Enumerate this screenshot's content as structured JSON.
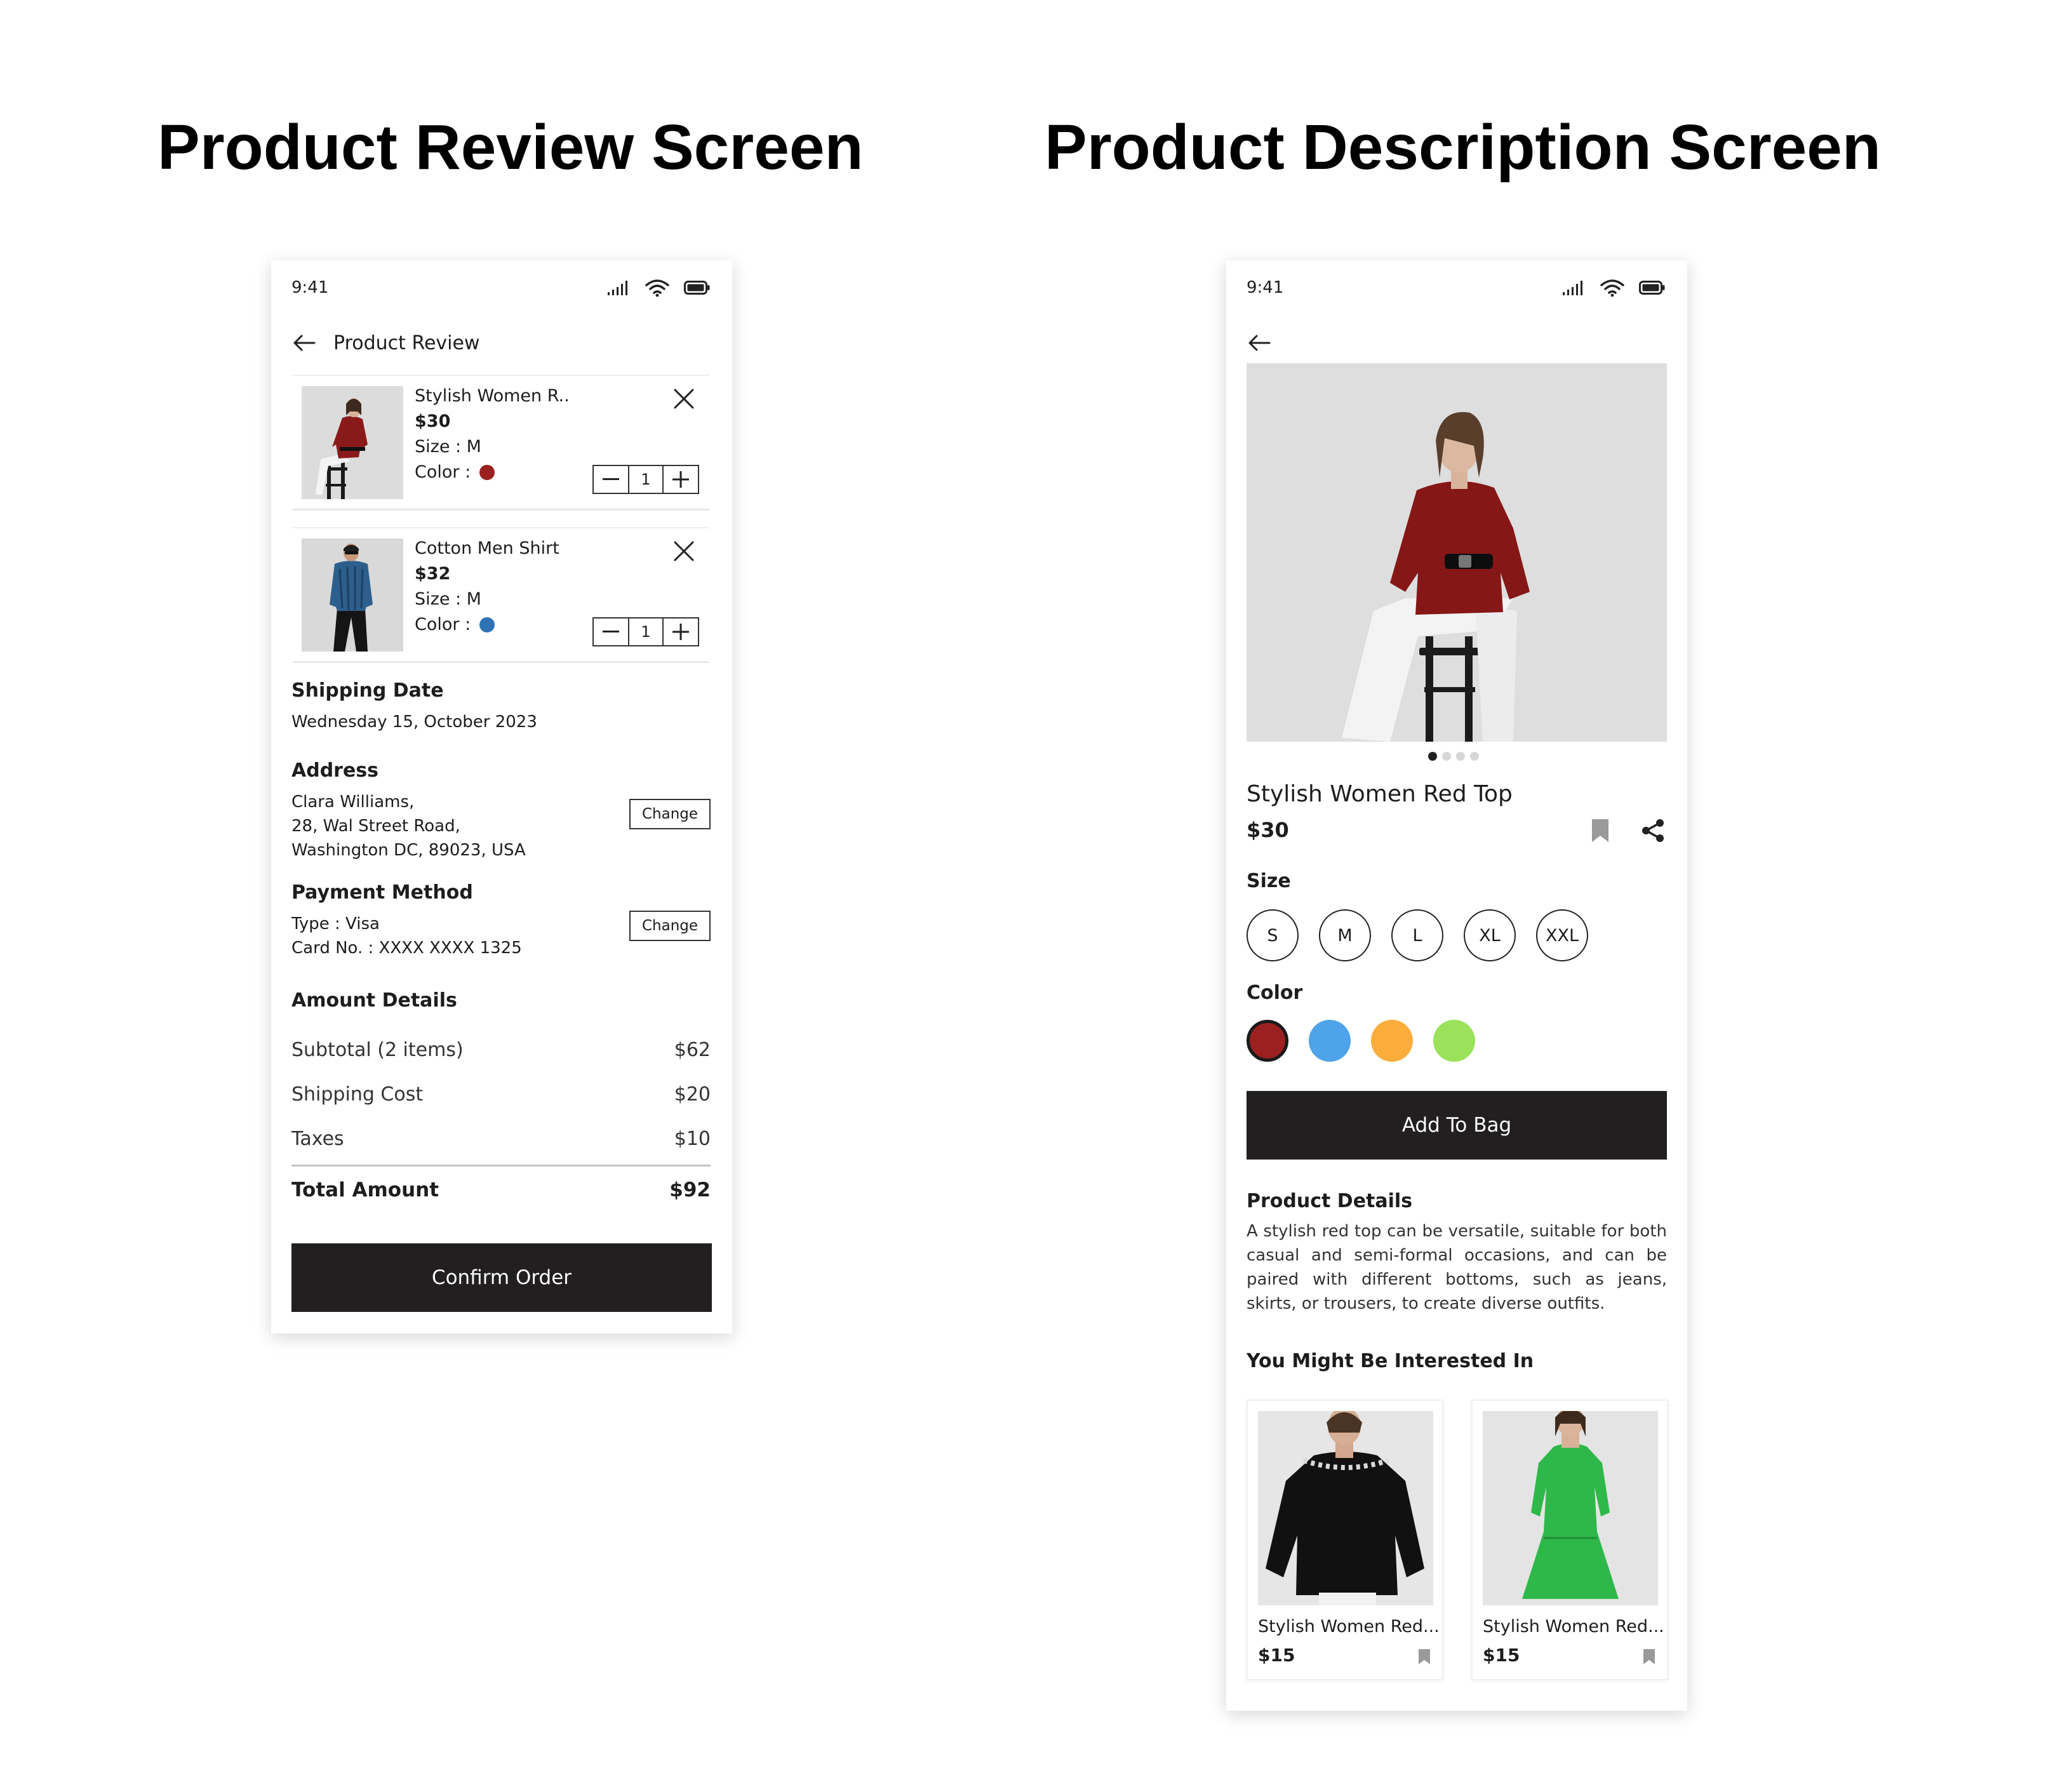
{
  "headings": {
    "left": "Product Review Screen",
    "right": "Product Description Screen"
  },
  "review_screen": {
    "status_time": "9:41",
    "header_title": "Product Review",
    "cart_items": [
      {
        "name": "Stylish  Women  R..",
        "price": "$30",
        "size": "Size : M",
        "color_label": "Color :",
        "color": "#9b2020",
        "qty": "1"
      },
      {
        "name": "Cotton Men Shirt",
        "price": "$32",
        "size": "Size : M",
        "color_label": "Color :",
        "color": "#2f73b5",
        "qty": "1"
      }
    ],
    "shipping": {
      "title": "Shipping Date",
      "value": "Wednesday 15, October 2023"
    },
    "address": {
      "title": "Address",
      "lines": [
        "Clara Williams,",
        "28, Wal Street Road,",
        "Washington DC, 89023, USA"
      ],
      "change_label": "Change"
    },
    "payment": {
      "title": "Payment Method",
      "type": "Type : Visa",
      "card": "Card No. : XXXX XXXX 1325",
      "change_label": "Change"
    },
    "amount": {
      "title": "Amount Details",
      "rows": [
        {
          "label": "Subtotal (2 items)",
          "value": "$62"
        },
        {
          "label": "Shipping Cost",
          "value": "$20"
        },
        {
          "label": "Taxes",
          "value": "$10"
        }
      ],
      "total_label": "Total Amount",
      "total_value": "$92"
    },
    "confirm_label": "Confirm Order"
  },
  "description_screen": {
    "status_time": "9:41",
    "carousel": {
      "count": 4,
      "active": 1
    },
    "product_name": "Stylish Women Red Top",
    "price": "$30",
    "size_title": "Size",
    "sizes": [
      "S",
      "M",
      "L",
      "XL",
      "XXL"
    ],
    "color_title": "Color",
    "colors": [
      "#9b2020",
      "#4fa3e8",
      "#fbad3b",
      "#99e25a"
    ],
    "selected_color": 0,
    "add_to_bag_label": "Add To Bag",
    "details_title": "Product Details",
    "details_text": "A stylish red top can be versatile, suitable for both casual and semi-formal occasions, and can be paired with different bottoms, such as jeans, skirts, or trousers, to create diverse outfits.",
    "recommend_title": "You Might Be Interested In",
    "recommendations": [
      {
        "name": "Stylish Women Red...",
        "price": "$15"
      },
      {
        "name": "Stylish Women Red...",
        "price": "$15"
      }
    ]
  },
  "icons": {
    "status": [
      "signal-icon",
      "wifi-icon",
      "battery-icon"
    ],
    "back": "arrow-left-icon",
    "remove": "close-icon",
    "bookmark": "bookmark-icon",
    "share": "share-icon"
  }
}
